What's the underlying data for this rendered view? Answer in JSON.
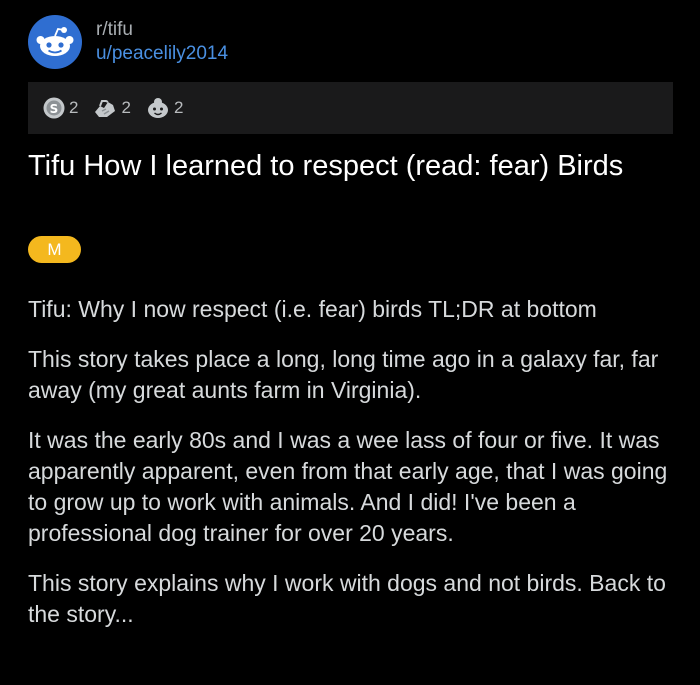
{
  "post": {
    "subreddit": "r/tifu",
    "username": "u/peacelily2014",
    "awards": [
      {
        "icon": "silver-award-icon",
        "count": "2"
      },
      {
        "icon": "helpful-award-icon",
        "count": "2"
      },
      {
        "icon": "wholesome-award-icon",
        "count": "2"
      }
    ],
    "title": "Tifu How I learned to respect (read: fear) Birds",
    "flair": "M",
    "paragraphs": [
      "Tifu: Why I now respect (i.e. fear) birds TL;DR at bottom",
      "This story takes place a long, long time ago in a galaxy far, far away (my great aunts farm in Virginia).",
      "It was the early 80s and I was a wee lass of four or five. It was apparently apparent, even from that early age, that I was going to grow up to work with animals. And I did! I've been a professional dog trainer for over 20 years.",
      "This story explains why I work with dogs and not birds. Back to the story..."
    ]
  },
  "colors": {
    "background": "#000000",
    "avatar": "#2f6ed1",
    "username": "#4a90e2",
    "flair": "#f4b81e",
    "awards_bar": "#1a1a1b"
  }
}
